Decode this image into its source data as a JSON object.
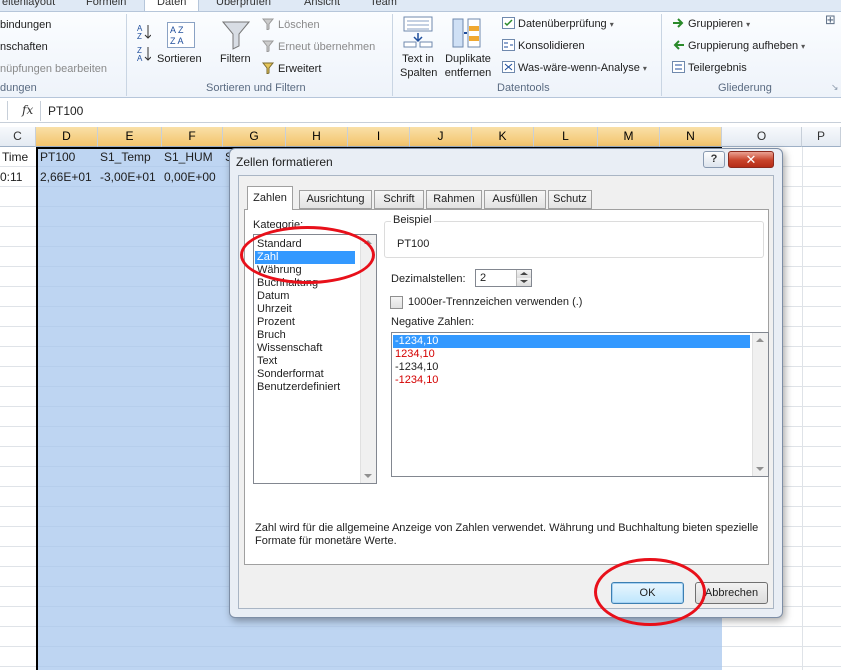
{
  "ribbon": {
    "tabs": [
      "eitenlayout",
      "Formeln",
      "Daten",
      "Überprüfen",
      "Ansicht",
      "Team"
    ],
    "active_tab": "Daten",
    "connections": {
      "items": [
        "bindungen",
        "nschaften",
        "nüpfungen bearbeiten"
      ],
      "group_label": "dungen"
    },
    "sort_filter": {
      "sort_label": "Sortieren",
      "filter_label": "Filtern",
      "clear_label": "Löschen",
      "reapply_label": "Erneut übernehmen",
      "advanced_label": "Erweitert",
      "group_label": "Sortieren und Filtern"
    },
    "data_tools": {
      "text_to_columns_label": "Text in\nSpalten",
      "remove_duplicates_label": "Duplikate\nentfernen",
      "validation_label": "Datenüberprüfung",
      "consolidate_label": "Konsolidieren",
      "whatif_label": "Was-wäre-wenn-Analyse",
      "group_label": "Datentools"
    },
    "outline": {
      "group_label": "Gruppieren",
      "ungroup_label": "Gruppierung aufheben",
      "subtotal_label": "Teilergebnis",
      "section_label": "Gliederung"
    }
  },
  "formula_bar": {
    "fx": "fx",
    "value": "PT100"
  },
  "sheet": {
    "columns": [
      "C",
      "D",
      "E",
      "F",
      "G",
      "H",
      "I",
      "J",
      "K",
      "L",
      "M",
      "N",
      "O",
      "P"
    ],
    "row1": [
      "Time",
      "PT100",
      "S1_Temp",
      "S1_HUM",
      "S"
    ],
    "row2": [
      "0:11",
      "2,66E+01",
      "-3,00E+01",
      "0,00E+00"
    ]
  },
  "dialog": {
    "title": "Zellen formatieren",
    "help": "?",
    "close": "✕",
    "tabs": [
      "Zahlen",
      "Ausrichtung",
      "Schrift",
      "Rahmen",
      "Ausfüllen",
      "Schutz"
    ],
    "active_tab": "Zahlen",
    "category_label": "Kategorie:",
    "categories": [
      "Standard",
      "Zahl",
      "Währung",
      "Buchhaltung",
      "Datum",
      "Uhrzeit",
      "Prozent",
      "Bruch",
      "Wissenschaft",
      "Text",
      "Sonderformat",
      "Benutzerdefiniert"
    ],
    "selected_category": "Zahl",
    "sample_label": "Beispiel",
    "sample_value": "PT100",
    "decimals_label": "Dezimalstellen:",
    "decimals_value": "2",
    "thousands_label": "1000er-Trennzeichen verwenden (.)",
    "thousands_checked": false,
    "negative_label": "Negative Zahlen:",
    "negative_options": [
      "-1234,10",
      "1234,10",
      "-1234,10",
      "-1234,10"
    ],
    "description": "Zahl wird für die allgemeine Anzeige von Zahlen verwendet. Währung und Buchhaltung bieten spezielle Formate für monetäre Werte.",
    "ok_label": "OK",
    "cancel_label": "Abbrechen"
  },
  "colors": {
    "highlight_circle": "#e8101a",
    "selection": "#3399ff",
    "negative_red": "#d40000"
  }
}
